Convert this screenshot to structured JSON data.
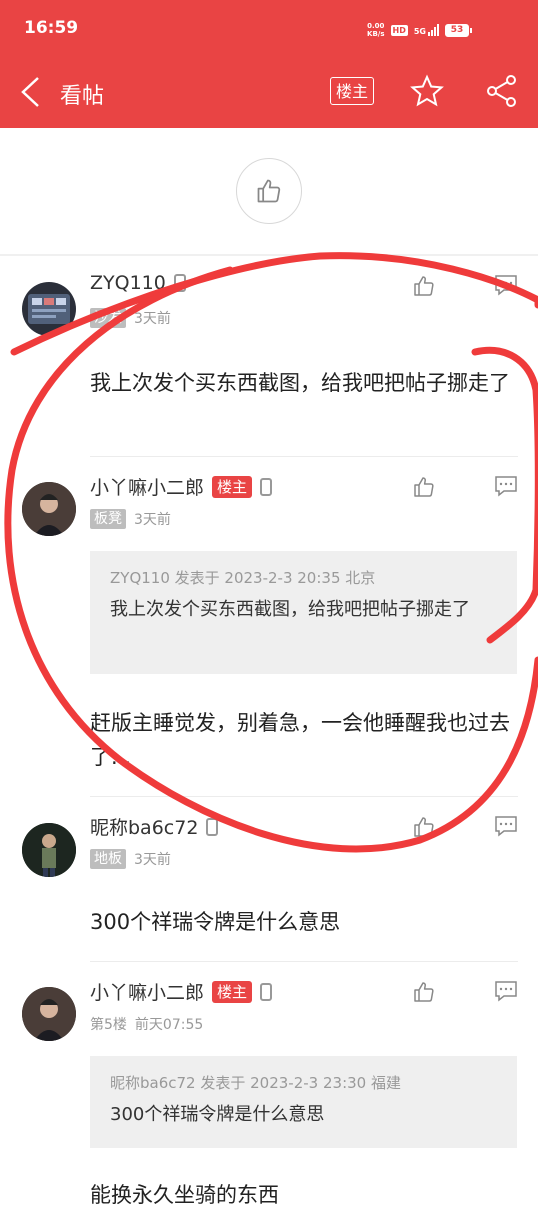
{
  "status_bar": {
    "time": "16:59",
    "net_speed_top": "0.00",
    "net_speed_unit": "KB/s",
    "hd": "HD",
    "signal": "5G",
    "battery": "53"
  },
  "header": {
    "title": "看帖",
    "louzhu_label": "楼主"
  },
  "posts": [
    {
      "username": "ZYQ110",
      "floor": "沙发",
      "time": "3天前",
      "content": "我上次发个买东西截图，给我吧把帖子挪走了"
    },
    {
      "username": "小丫嘛小二郎",
      "badge": "楼主",
      "floor": "板凳",
      "time": "3天前",
      "quote_meta": "ZYQ110 发表于 2023-2-3 20:35 北京",
      "quote_text": "我上次发个买东西截图，给我吧把帖子挪走了",
      "content": "赶版主睡觉发，别着急，一会他睡醒我也过去了..."
    },
    {
      "username": "昵称ba6c72",
      "floor": "地板",
      "time": "3天前",
      "content": "300个祥瑞令牌是什么意思"
    },
    {
      "username": "小丫嘛小二郎",
      "badge": "楼主",
      "floor": "第5楼",
      "time": "前天07:55",
      "quote_meta": "昵称ba6c72 发表于 2023-2-3 23:30 福建",
      "quote_text": "300个祥瑞令牌是什么意思",
      "content": "能换永久坐骑的东西"
    }
  ],
  "colors": {
    "accent": "#e94444",
    "annotation": "#ef3b3b"
  }
}
